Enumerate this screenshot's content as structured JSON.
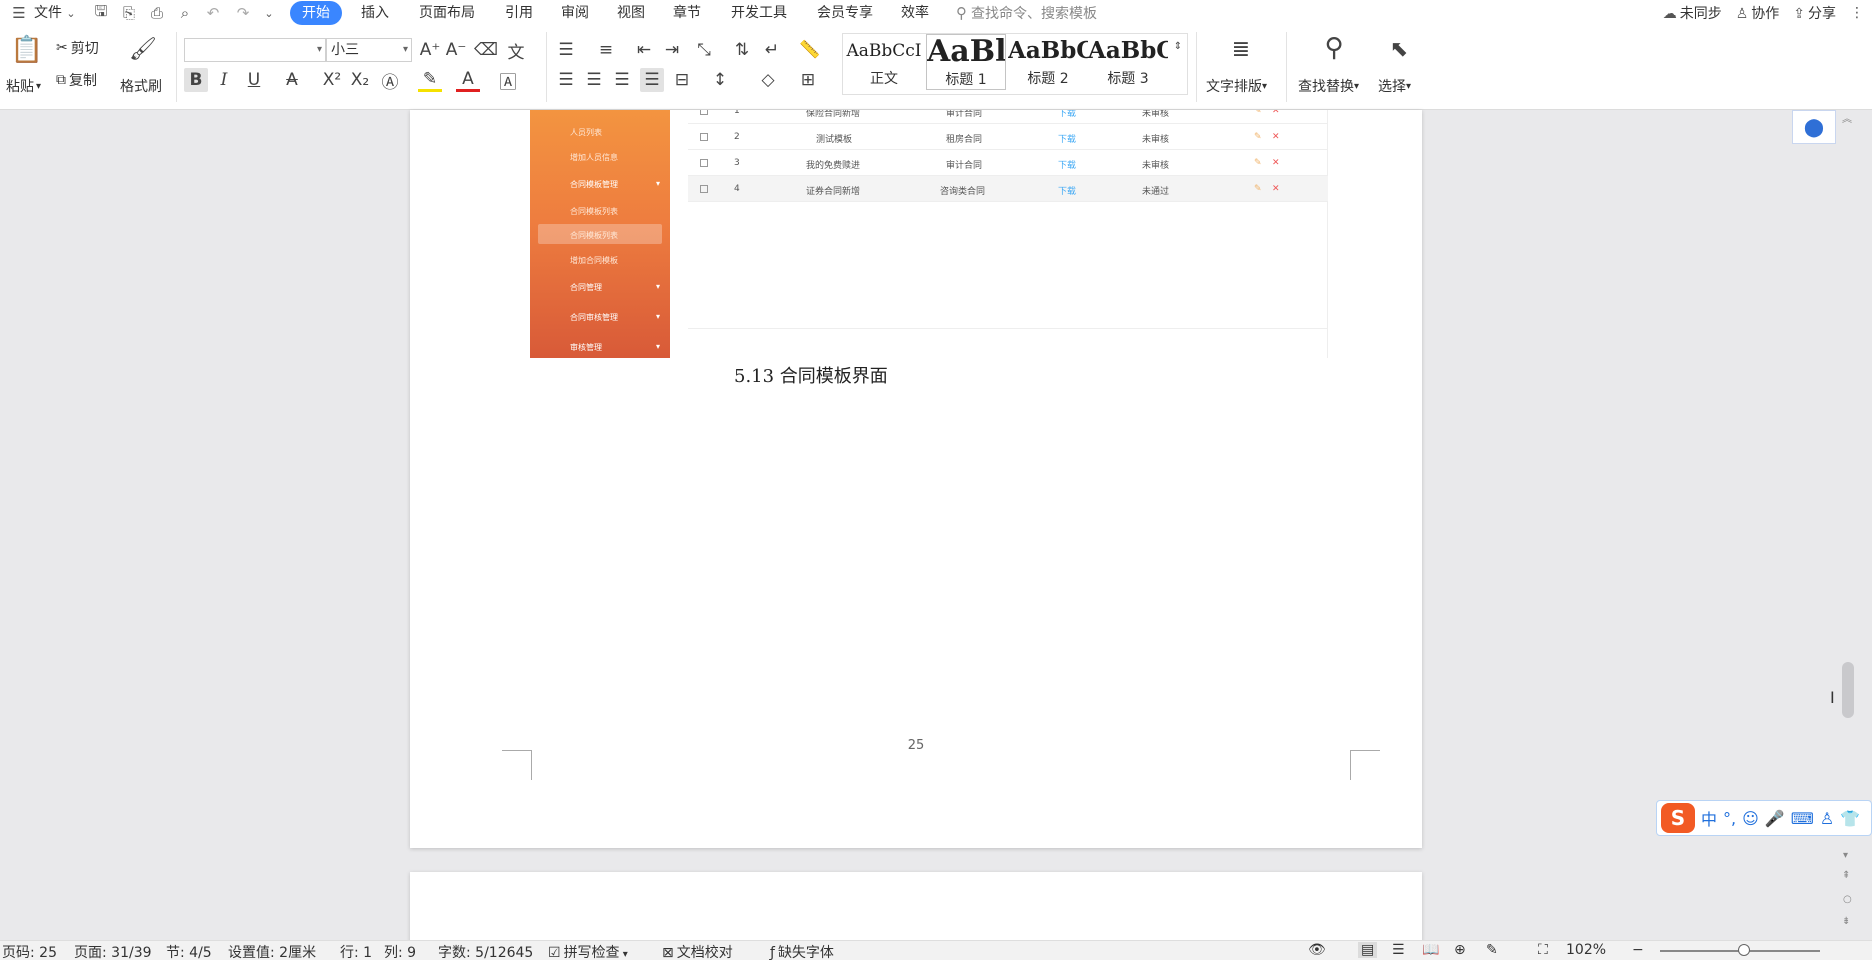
{
  "menu": {
    "file": "文件",
    "tabs": [
      "开始",
      "插入",
      "页面布局",
      "引用",
      "审阅",
      "视图",
      "章节",
      "开发工具",
      "会员专享",
      "效率"
    ],
    "search_placeholder": "查找命令、搜索模板",
    "right": {
      "sync": "未同步",
      "collab": "协作",
      "share": "分享"
    }
  },
  "ribbon": {
    "paste": "粘贴",
    "cut": "剪切",
    "copy": "复制",
    "format_painter": "格式刷",
    "font_name": "",
    "font_size": "小三",
    "styles": [
      {
        "preview": "AaBbCcI",
        "label": "正文"
      },
      {
        "preview": "AaBl",
        "label": "标题 1"
      },
      {
        "preview": "AaBbC",
        "label": "标题 2"
      },
      {
        "preview": "AaBbC",
        "label": "标题 3"
      }
    ],
    "text_layout": "文字排版",
    "find_replace": "查找替换",
    "select": "选择"
  },
  "embedded_app": {
    "sidebar_items": [
      "人员列表",
      "增加人员信息",
      "合同模板管理",
      "合同模板列表",
      "合同模板列表",
      "增加合同模板",
      "合同管理",
      "合同审核管理",
      "审核管理"
    ],
    "rows": [
      {
        "no": "1",
        "name": "保险合同新增",
        "type": "审计合同",
        "download": "下载",
        "status": "未审核"
      },
      {
        "no": "2",
        "name": "测试模板",
        "type": "租房合同",
        "download": "下载",
        "status": "未审核"
      },
      {
        "no": "3",
        "name": "我的免费赎进",
        "type": "审计合同",
        "download": "下载",
        "status": "未审核"
      },
      {
        "no": "4",
        "name": "证券合同新增",
        "type": "咨询类合同",
        "download": "下载",
        "status": "未通过"
      }
    ]
  },
  "document": {
    "caption": "5.13  合同模板界面",
    "page_number": "25"
  },
  "status": {
    "page_code": "页码: 25",
    "page": "页面: 31/39",
    "section": "节: 4/5",
    "setting": "设置值: 2厘米",
    "line": "行: 1",
    "column": "列: 9",
    "word_count": "字数: 5/12645",
    "spell_check": "拼写检查",
    "doc_check": "文档校对",
    "missing_font": "缺失字体",
    "zoom": "102%"
  },
  "colors": {
    "accent": "#3a86ff",
    "sidebar_top": "#f39440",
    "sidebar_bottom": "#d85a38",
    "ime_logo": "#f25a24"
  }
}
